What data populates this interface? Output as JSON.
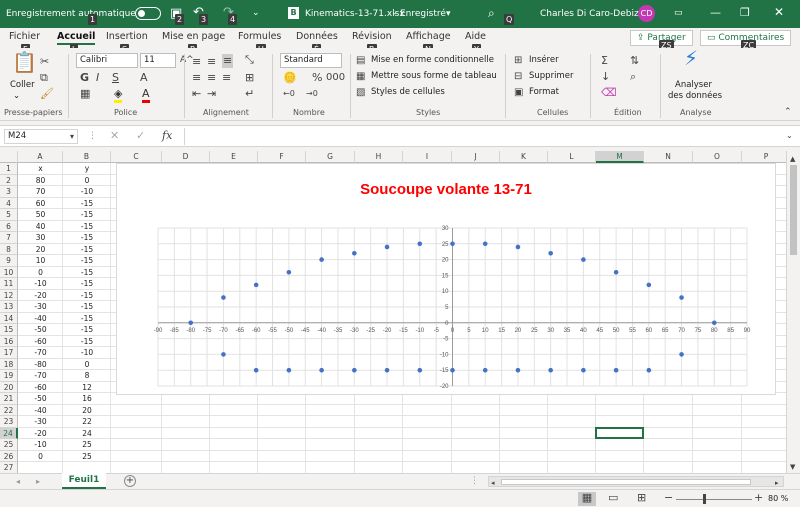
{
  "titlebar": {
    "autosave_label": "Enregistrement automatique",
    "filename": "Kinematics-13-71.xlsx",
    "saved_status": "Enregistré",
    "user_name": "Charles Di Caro-Debizet",
    "user_initials": "CD",
    "keytips": {
      "autosave": "1",
      "save": "2",
      "undo": "3",
      "redo": "4",
      "search": "Q"
    }
  },
  "menu": {
    "tabs": [
      "Fichier",
      "Accueil",
      "Insertion",
      "Mise en page",
      "Formules",
      "Données",
      "Révision",
      "Affichage",
      "Aide"
    ],
    "keytips": [
      "F",
      "L",
      "S",
      "P",
      "U",
      "É",
      "R",
      "N",
      "Y"
    ],
    "share_label": "Partager",
    "share_keytip": "ZS",
    "comments_label": "Commentaires",
    "comments_keytip": "ZC"
  },
  "ribbon": {
    "paste_label": "Coller",
    "font_name": "Calibri",
    "font_size": "11",
    "number_format": "Standard",
    "conditional_format": "Mise en forme conditionnelle",
    "format_as_table": "Mettre sous forme de tableau",
    "cell_styles": "Styles de cellules",
    "insert": "Insérer",
    "delete": "Supprimer",
    "format": "Format",
    "analyze_line1": "Analyser",
    "analyze_line2": "des données",
    "groups": [
      "Presse-papiers",
      "Police",
      "Alignement",
      "Nombre",
      "Styles",
      "Cellules",
      "Édition",
      "Analyse"
    ]
  },
  "formula_bar": {
    "name_box": "M24",
    "fx": "fx",
    "content": ""
  },
  "sheet": {
    "columns": [
      "A",
      "B",
      "C",
      "D",
      "E",
      "F",
      "G",
      "H",
      "I",
      "J",
      "K",
      "L",
      "M",
      "N",
      "O",
      "P"
    ],
    "rows": [
      "1",
      "2",
      "3",
      "4",
      "5",
      "6",
      "7",
      "8",
      "9",
      "10",
      "11",
      "12",
      "13",
      "14",
      "15",
      "16",
      "17",
      "18",
      "19",
      "20",
      "21",
      "22",
      "23",
      "24",
      "25",
      "26",
      "27"
    ],
    "data": [
      [
        "x",
        "y"
      ],
      [
        "80",
        "0"
      ],
      [
        "70",
        "-10"
      ],
      [
        "60",
        "-15"
      ],
      [
        "50",
        "-15"
      ],
      [
        "40",
        "-15"
      ],
      [
        "30",
        "-15"
      ],
      [
        "20",
        "-15"
      ],
      [
        "10",
        "-15"
      ],
      [
        "0",
        "-15"
      ],
      [
        "-10",
        "-15"
      ],
      [
        "-20",
        "-15"
      ],
      [
        "-30",
        "-15"
      ],
      [
        "-40",
        "-15"
      ],
      [
        "-50",
        "-15"
      ],
      [
        "-60",
        "-15"
      ],
      [
        "-70",
        "-10"
      ],
      [
        "-80",
        "0"
      ],
      [
        "-70",
        "8"
      ],
      [
        "-60",
        "12"
      ],
      [
        "-50",
        "16"
      ],
      [
        "-40",
        "20"
      ],
      [
        "-30",
        "22"
      ],
      [
        "-20",
        "24"
      ],
      [
        "-10",
        "25"
      ],
      [
        "0",
        "25"
      ]
    ],
    "selected_cell": "M24",
    "tab_name": "Feuil1"
  },
  "chart_data": {
    "type": "scatter",
    "title": "Soucoupe volante 13-71",
    "title_color": "#ff0000",
    "marker_color": "#4472c4",
    "xlim": [
      -90,
      90
    ],
    "ylim": [
      -20,
      30
    ],
    "xticks": [
      -90,
      -85,
      -80,
      -75,
      -70,
      -65,
      -60,
      -55,
      -50,
      -45,
      -40,
      -35,
      -30,
      -25,
      -20,
      -15,
      -10,
      -5,
      0,
      5,
      10,
      15,
      20,
      25,
      30,
      35,
      40,
      45,
      50,
      55,
      60,
      65,
      70,
      75,
      80,
      85,
      90
    ],
    "yticks": [
      -20,
      -15,
      -10,
      -5,
      0,
      5,
      10,
      15,
      20,
      25,
      30
    ],
    "grid": true,
    "points": [
      [
        80,
        0
      ],
      [
        70,
        -10
      ],
      [
        60,
        -15
      ],
      [
        50,
        -15
      ],
      [
        40,
        -15
      ],
      [
        30,
        -15
      ],
      [
        20,
        -15
      ],
      [
        10,
        -15
      ],
      [
        0,
        -15
      ],
      [
        -10,
        -15
      ],
      [
        -20,
        -15
      ],
      [
        -30,
        -15
      ],
      [
        -40,
        -15
      ],
      [
        -50,
        -15
      ],
      [
        -60,
        -15
      ],
      [
        -70,
        -10
      ],
      [
        -80,
        0
      ],
      [
        -70,
        8
      ],
      [
        -60,
        12
      ],
      [
        -50,
        16
      ],
      [
        -40,
        20
      ],
      [
        -30,
        22
      ],
      [
        -20,
        24
      ],
      [
        -10,
        25
      ],
      [
        0,
        25
      ],
      [
        10,
        25
      ],
      [
        20,
        24
      ],
      [
        30,
        22
      ],
      [
        40,
        20
      ],
      [
        50,
        16
      ],
      [
        60,
        12
      ],
      [
        70,
        8
      ]
    ]
  },
  "status": {
    "zoom": "80 %"
  },
  "colors": {
    "excel_green": "#217346",
    "accent_pink": "#c239b3"
  }
}
